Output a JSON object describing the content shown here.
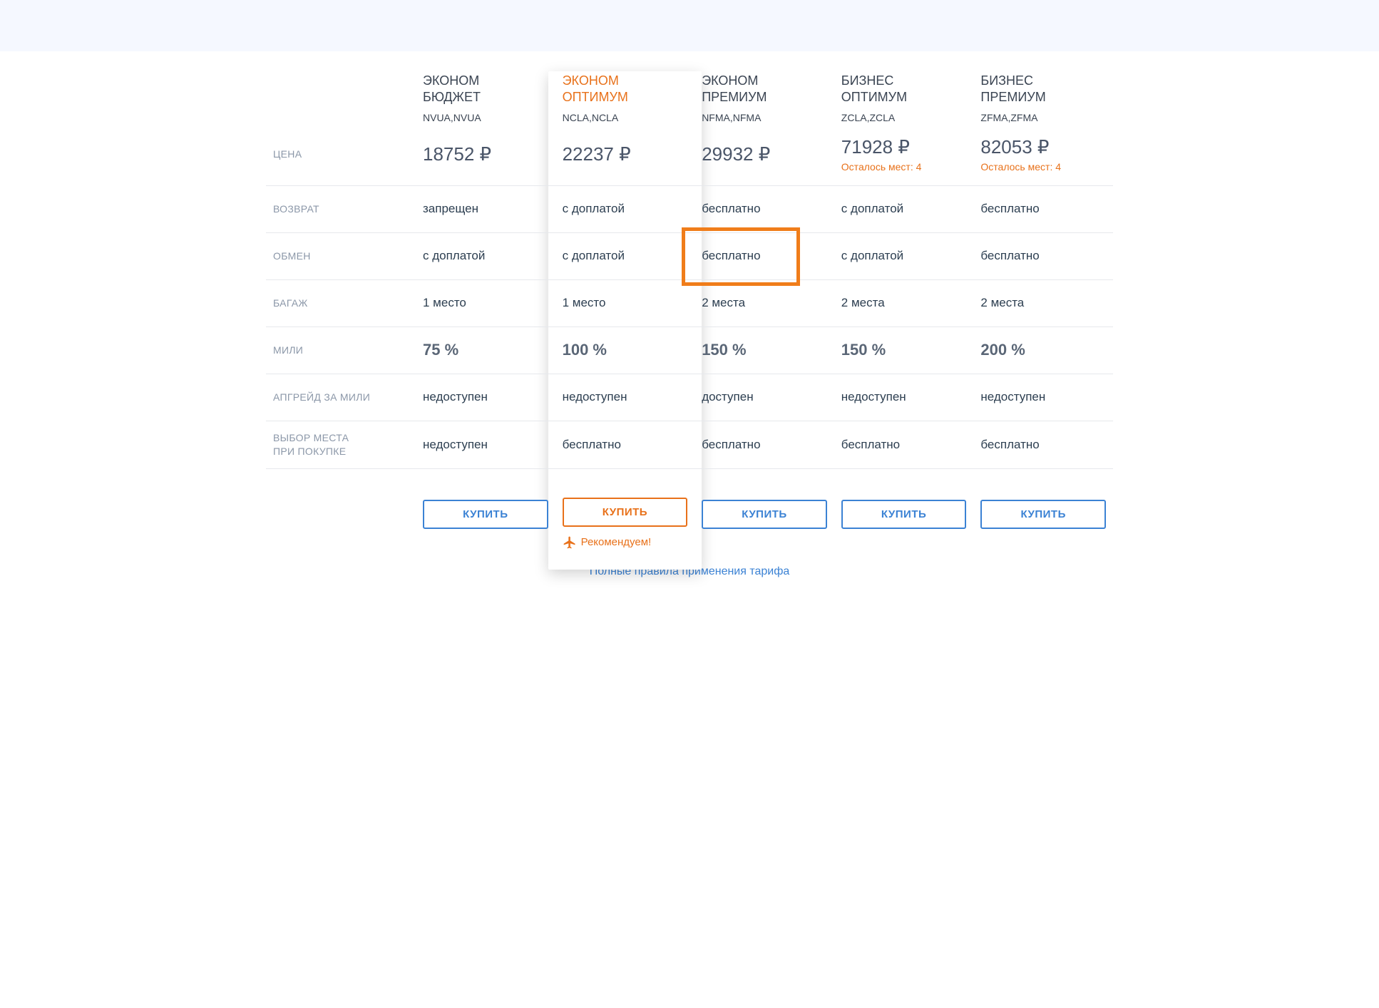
{
  "rowLabels": {
    "price": "ЦЕНА",
    "refund": "ВОЗВРАТ",
    "exchange": "ОБМЕН",
    "baggage": "БАГАЖ",
    "miles": "МИЛИ",
    "upgrade": "АПГРЕЙД ЗА МИЛИ",
    "seat1": "ВЫБОР МЕСТА",
    "seat2": "ПРИ ПОКУПКЕ"
  },
  "currency": "₽",
  "columns": [
    {
      "name1": "ЭКОНОМ",
      "name2": "БЮДЖЕТ",
      "code": "NVUA,NVUA",
      "price": "18752 ₽",
      "seatsLeft": "",
      "refund": "запрещен",
      "exchange": "с доплатой",
      "baggage": "1 место",
      "miles": "75 %",
      "upgrade": "недоступен",
      "seat": "недоступен",
      "buy": "КУПИТЬ",
      "recommend": ""
    },
    {
      "name1": "ЭКОНОМ",
      "name2": "ОПТИМУМ",
      "code": "NCLA,NCLA",
      "price": "22237 ₽",
      "seatsLeft": "",
      "refund": "с доплатой",
      "exchange": "с доплатой",
      "baggage": "1 место",
      "miles": "100 %",
      "upgrade": "недоступен",
      "seat": "бесплатно",
      "buy": "КУПИТЬ",
      "recommend": "Рекомендуем!"
    },
    {
      "name1": "ЭКОНОМ",
      "name2": "ПРЕМИУМ",
      "code": "NFMA,NFMA",
      "price": "29932 ₽",
      "seatsLeft": "",
      "refund": "бесплатно",
      "exchange": "бесплатно",
      "baggage": "2 места",
      "miles": "150 %",
      "upgrade": "доступен",
      "seat": "бесплатно",
      "buy": "КУПИТЬ",
      "recommend": ""
    },
    {
      "name1": "БИЗНЕС",
      "name2": "ОПТИМУМ",
      "code": "ZCLA,ZCLA",
      "price": "71928 ₽",
      "seatsLeft": "Осталось мест: 4",
      "refund": "с доплатой",
      "exchange": "с доплатой",
      "baggage": "2 места",
      "miles": "150 %",
      "upgrade": "недоступен",
      "seat": "бесплатно",
      "buy": "КУПИТЬ",
      "recommend": ""
    },
    {
      "name1": "БИЗНЕС",
      "name2": "ПРЕМИУМ",
      "code": "ZFMA,ZFMA",
      "price": "82053 ₽",
      "seatsLeft": "Осталось мест: 4",
      "refund": "бесплатно",
      "exchange": "бесплатно",
      "baggage": "2 места",
      "miles": "200 %",
      "upgrade": "недоступен",
      "seat": "бесплатно",
      "buy": "КУПИТЬ",
      "recommend": ""
    }
  ],
  "footerLink": "Полные правила применения тарифа",
  "highlightedColumn": 1,
  "orangeBoxCell": {
    "row": "exchange",
    "col": 2
  }
}
